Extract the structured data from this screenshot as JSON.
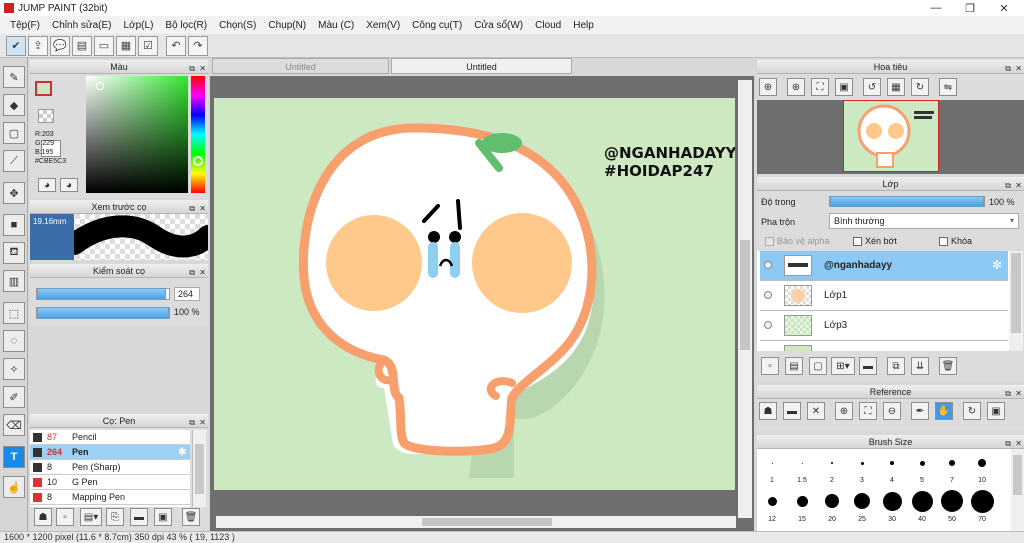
{
  "app": {
    "title": "JUMP PAINT (32bit)",
    "window_buttons": [
      "—",
      "❐",
      "✕"
    ]
  },
  "menu": [
    "Tệp(F)",
    "Chỉnh sửa(E)",
    "Lớp(L)",
    "Bộ lọc(R)",
    "Chọn(S)",
    "Chụp(N)",
    "Màu (C)",
    "Xem(V)",
    "Công cụ(T)",
    "Cửa sổ(W)",
    "Cloud",
    "Help"
  ],
  "tabs": [
    "Untitled",
    "Untitled"
  ],
  "color_panel": {
    "title": "Màu",
    "r": "R:203",
    "g": "G:229",
    "b": "B:195",
    "hex": "#CBE5C3",
    "fg_color": "#cbe5c3"
  },
  "preview_panel": {
    "title": "Xem trước cọ",
    "size": "19.16mm"
  },
  "brush_control": {
    "title": "Kiểm soát cọ",
    "size_value": "264",
    "opacity_value": "100 %",
    "size_fraction": 0.98,
    "opacity_fraction": 1.0
  },
  "brush_list": {
    "title": "Cọ: Pen",
    "items": [
      {
        "size": "87",
        "name": "Pencil",
        "color": "#333333"
      },
      {
        "size": "264",
        "name": "Pen",
        "color": "#333333"
      },
      {
        "size": "8",
        "name": "Pen (Sharp)",
        "color": "#333333"
      },
      {
        "size": "10",
        "name": "G Pen",
        "color": "#e03030"
      },
      {
        "size": "8",
        "name": "Mapping Pen",
        "color": "#e03030"
      }
    ]
  },
  "navigator": {
    "title": "Hoa tiêu"
  },
  "layer_panel": {
    "title": "Lớp",
    "opacity_label": "Độ trong",
    "opacity_value": "100 %",
    "blend_label": "Pha trộn",
    "blend_value": "Bình thường",
    "protect_alpha": "Bảo vệ alpha",
    "clipping": "Xén bớt",
    "lock": "Khóa",
    "layers": [
      "@nganhadayy",
      "Lớp1",
      "Lớp3"
    ]
  },
  "reference_panel": {
    "title": "Reference"
  },
  "brush_size_panel": {
    "title": "Brush Size",
    "row1": [
      "1",
      "1.5",
      "2",
      "3",
      "4",
      "5",
      "7",
      "10"
    ],
    "row2": [
      "12",
      "15",
      "20",
      "25",
      "30",
      "40",
      "50",
      "70"
    ]
  },
  "canvas": {
    "watermark_line1": "@NGANHADAYY",
    "watermark_line2": "#HOIDAP247",
    "bg_color": "#cde9c2"
  },
  "status": "1600 * 1200 pixel   (11.6 * 8.7cm)   350 dpi   43 %   ( 19, 1123 )"
}
